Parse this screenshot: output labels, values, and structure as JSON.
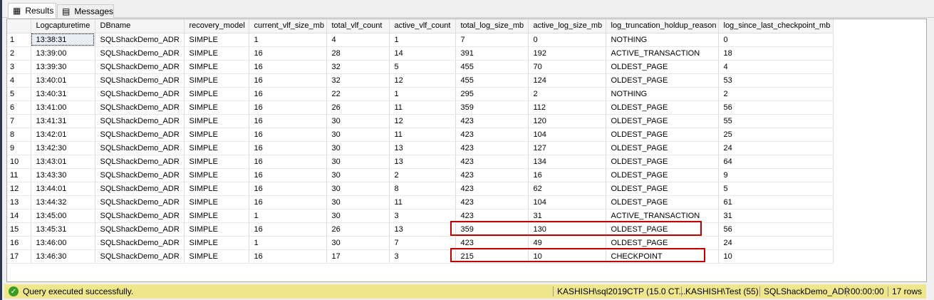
{
  "tabs": [
    {
      "label": "Results",
      "icon": "grid-icon"
    },
    {
      "label": "Messages",
      "icon": "messages-icon"
    }
  ],
  "columns": [
    "",
    "Logcapturetime",
    "DBname",
    "recovery_model",
    "current_vlf_size_mb",
    "total_vlf_count",
    "active_vlf_count",
    "total_log_size_mb",
    "active_log_size_mb",
    "log_truncation_holdup_reason",
    "log_since_last_checkpoint_mb"
  ],
  "rows": [
    [
      "1",
      "13:38:31",
      "SQLShackDemo_ADR",
      "SIMPLE",
      "1",
      "4",
      "1",
      "7",
      "0",
      "NOTHING",
      "0"
    ],
    [
      "2",
      "13:39:00",
      "SQLShackDemo_ADR",
      "SIMPLE",
      "16",
      "28",
      "14",
      "391",
      "192",
      "ACTIVE_TRANSACTION",
      "18"
    ],
    [
      "3",
      "13:39:30",
      "SQLShackDemo_ADR",
      "SIMPLE",
      "16",
      "32",
      "5",
      "455",
      "70",
      "OLDEST_PAGE",
      "4"
    ],
    [
      "4",
      "13:40:01",
      "SQLShackDemo_ADR",
      "SIMPLE",
      "16",
      "32",
      "12",
      "455",
      "124",
      "OLDEST_PAGE",
      "53"
    ],
    [
      "5",
      "13:40:31",
      "SQLShackDemo_ADR",
      "SIMPLE",
      "16",
      "22",
      "1",
      "295",
      "2",
      "NOTHING",
      "2"
    ],
    [
      "6",
      "13:41:00",
      "SQLShackDemo_ADR",
      "SIMPLE",
      "16",
      "26",
      "11",
      "359",
      "112",
      "OLDEST_PAGE",
      "56"
    ],
    [
      "7",
      "13:41:31",
      "SQLShackDemo_ADR",
      "SIMPLE",
      "16",
      "30",
      "12",
      "423",
      "120",
      "OLDEST_PAGE",
      "55"
    ],
    [
      "8",
      "13:42:01",
      "SQLShackDemo_ADR",
      "SIMPLE",
      "16",
      "30",
      "11",
      "423",
      "104",
      "OLDEST_PAGE",
      "25"
    ],
    [
      "9",
      "13:42:30",
      "SQLShackDemo_ADR",
      "SIMPLE",
      "16",
      "30",
      "13",
      "423",
      "127",
      "OLDEST_PAGE",
      "24"
    ],
    [
      "10",
      "13:43:01",
      "SQLShackDemo_ADR",
      "SIMPLE",
      "16",
      "30",
      "13",
      "423",
      "134",
      "OLDEST_PAGE",
      "64"
    ],
    [
      "11",
      "13:43:30",
      "SQLShackDemo_ADR",
      "SIMPLE",
      "16",
      "30",
      "2",
      "423",
      "16",
      "OLDEST_PAGE",
      "9"
    ],
    [
      "12",
      "13:44:01",
      "SQLShackDemo_ADR",
      "SIMPLE",
      "16",
      "30",
      "8",
      "423",
      "62",
      "OLDEST_PAGE",
      "5"
    ],
    [
      "13",
      "13:44:32",
      "SQLShackDemo_ADR",
      "SIMPLE",
      "16",
      "30",
      "11",
      "423",
      "104",
      "OLDEST_PAGE",
      "61"
    ],
    [
      "14",
      "13:45:00",
      "SQLShackDemo_ADR",
      "SIMPLE",
      "1",
      "30",
      "3",
      "423",
      "31",
      "ACTIVE_TRANSACTION",
      "31"
    ],
    [
      "15",
      "13:45:31",
      "SQLShackDemo_ADR",
      "SIMPLE",
      "16",
      "26",
      "13",
      "359",
      "130",
      "OLDEST_PAGE",
      "56"
    ],
    [
      "16",
      "13:46:00",
      "SQLShackDemo_ADR",
      "SIMPLE",
      "1",
      "30",
      "7",
      "423",
      "49",
      "OLDEST_PAGE",
      "24"
    ],
    [
      "17",
      "13:46:30",
      "SQLShackDemo_ADR",
      "SIMPLE",
      "16",
      "17",
      "3",
      "215",
      "10",
      "CHECKPOINT",
      "10"
    ]
  ],
  "highlighted_rows": [
    15,
    17
  ],
  "highlight_color": "#c00000",
  "status": {
    "message": "Query executed successfully.",
    "server": "KASHISH\\sql2019CTP (15.0 CT...",
    "user": "KASHISH\\Test (55)",
    "database": "SQLShackDemo_ADR",
    "elapsed": "00:00:00",
    "rows": "17 rows",
    "color": "#f0e68c"
  }
}
